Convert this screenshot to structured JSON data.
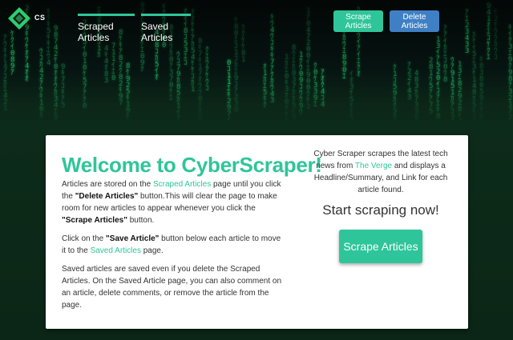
{
  "brand": {
    "logo_text": "CS"
  },
  "nav": {
    "scraped_label": "Scraped Articles",
    "saved_label": "Saved Articles"
  },
  "header_buttons": {
    "scrape_label": "Scrape Articles",
    "delete_label": "Delete Articles"
  },
  "welcome": {
    "title": "Welcome to CyberScraper!",
    "p1": {
      "t1": "Articles are stored on the ",
      "link1": "Scraped Articles",
      "t2": " page until you click the ",
      "bold1": "\"Delete Articles\"",
      "t3": " button.This will clear the page to make room for new articles to appear whenever you click the ",
      "bold2": "\"Scrape Articles\"",
      "t4": " button."
    },
    "p2": {
      "t1": "Click on the ",
      "bold1": "\"Save Article\"",
      "t2": " button below each article to move it to the ",
      "link1": "Saved Articles",
      "t3": " page."
    },
    "p3": "Saved articles are saved even if you delete the Scraped Articles. On the Saved Article page, you can also comment on an article, delete comments, or remove the article from the page."
  },
  "info": {
    "t1": "Cyber Scraper scrapes the latest tech news from ",
    "link": "The Verge",
    "t2": " and displays a Headline/Summary, and Link for each article found.",
    "start": "Start scraping now!",
    "button_label": "Scrape Articles"
  },
  "colors": {
    "accent": "#2fc59a",
    "delete_button": "#3f80c4",
    "background": "#0b2616",
    "matrix_green": "#2ecc71"
  }
}
